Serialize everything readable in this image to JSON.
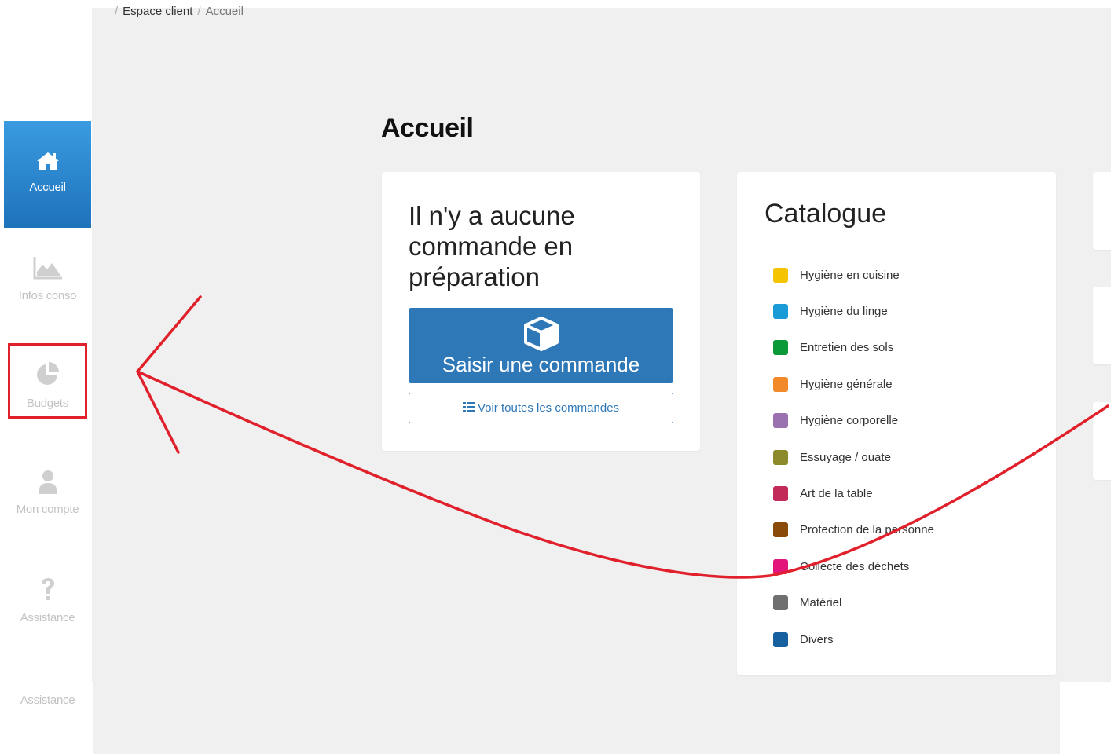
{
  "breadcrumb": {
    "items": [
      "Espace client",
      "Accueil"
    ]
  },
  "sidebar": {
    "items": [
      {
        "label": "Accueil",
        "icon": "home-icon"
      },
      {
        "label": "Infos conso",
        "icon": "area-chart-icon"
      },
      {
        "label": "Budgets",
        "icon": "pie-chart-icon"
      },
      {
        "label": "Mon compte",
        "icon": "user-icon"
      },
      {
        "label": "Assistance",
        "icon": "question-icon"
      }
    ],
    "footer_label": "Assistance"
  },
  "page": {
    "title": "Accueil"
  },
  "orders": {
    "title": "Il n'y a aucune commande en préparation",
    "primary_button": "Saisir une commande",
    "secondary_button": "Voir toutes les commandes"
  },
  "catalog": {
    "title": "Catalogue",
    "items": [
      {
        "label": "Hygiène en cuisine",
        "color": "#f5c400"
      },
      {
        "label": "Hygiène du linge",
        "color": "#1a9ad6"
      },
      {
        "label": "Entretien des sols",
        "color": "#0a9a3a"
      },
      {
        "label": "Hygiène générale",
        "color": "#f28a2c"
      },
      {
        "label": "Hygiène corporelle",
        "color": "#9a72b0"
      },
      {
        "label": "Essuyage / ouate",
        "color": "#8c8a2a"
      },
      {
        "label": "Art de la table",
        "color": "#c22a5a"
      },
      {
        "label": "Protection de la personne",
        "color": "#8a4a0a"
      },
      {
        "label": "Collecte des déchets",
        "color": "#e2157a"
      },
      {
        "label": "Matériel",
        "color": "#707070"
      },
      {
        "label": "Divers",
        "color": "#1660a0"
      }
    ]
  },
  "colors": {
    "accent": "#2f78b8",
    "annotation": "#e0202a",
    "background": "#f0f0f0"
  }
}
